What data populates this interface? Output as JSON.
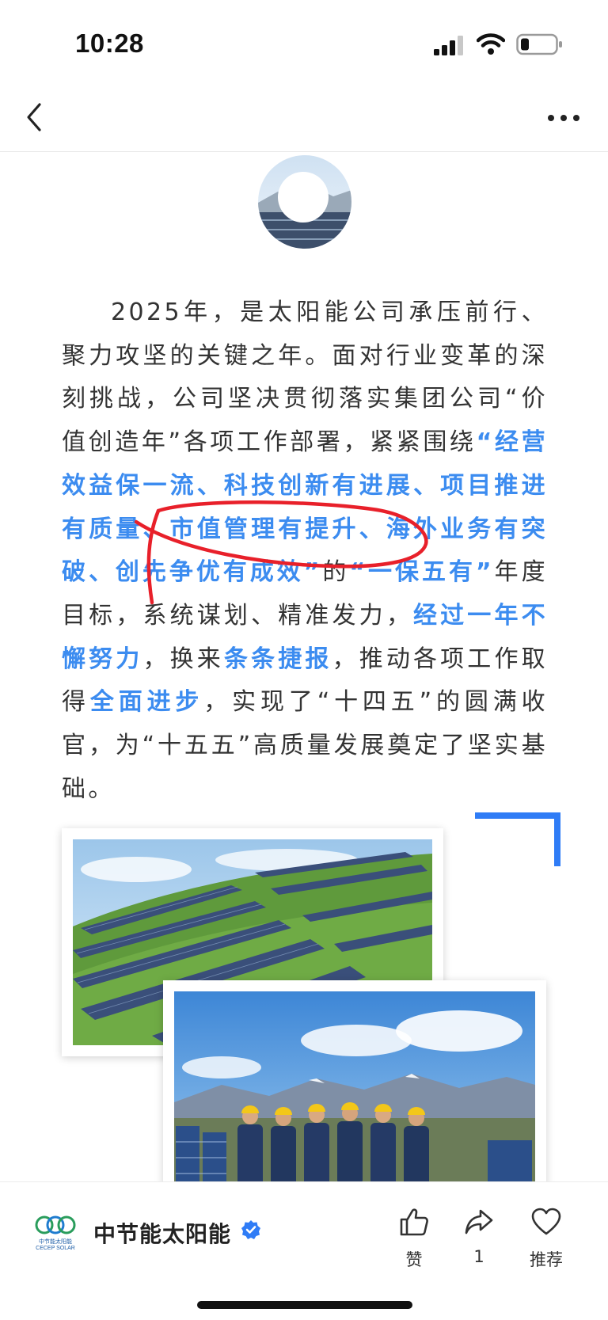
{
  "status_bar": {
    "time": "10:28",
    "icons": [
      "signal-icon",
      "wifi-icon",
      "battery-icon"
    ]
  },
  "nav": {
    "icons": [
      "back-icon",
      "more-icon"
    ]
  },
  "article": {
    "p_1": "2025年，是太阳能公司承压前行、聚力攻坚的关键之年。面对行业变革的深刻挑战，公司坚决贯彻落实集团公司“价值创造年”各项工作部署，紧紧围绕",
    "hl_1": "“经营效益保一流、科技创新有进展、项目推进有质量、市值管理有提升、海外业务有突破、创先争优有成效”",
    "p_2": "的",
    "hl_2": "“一保五有”",
    "p_3": "年度目标，系统谋划、精准发力，",
    "hl_3": "经过一年不懈努力",
    "p_4": "，换来",
    "hl_4": "条条捷报",
    "p_5": "，推动各项工作取得",
    "hl_5": "全面进步",
    "p_6": "，实现了“十四五”的圆满收官，为“十五五”高质量发展奠定了坚实基础。"
  },
  "brand": {
    "name": "中节能太阳能",
    "logo_cn": "中节能太阳能",
    "logo_en": "CECEP SOLAR"
  },
  "actions": {
    "like_label": "赞",
    "share_label": "1",
    "recommend_label": "推荐"
  },
  "colors": {
    "highlight": "#3c8cf0",
    "annotation": "#e8202a",
    "verified": "#2f7cf6"
  }
}
